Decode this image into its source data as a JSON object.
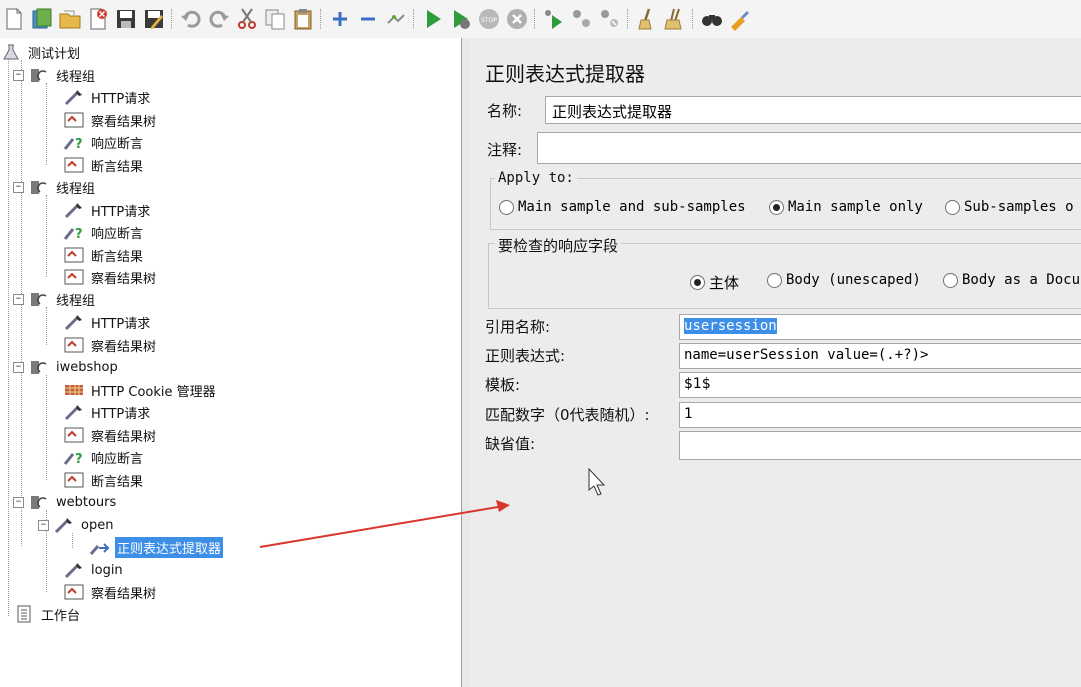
{
  "toolbar": {
    "icons": [
      "new-icon",
      "templates-icon",
      "open-icon",
      "close-icon",
      "save-icon",
      "save-as-icon",
      "undo-icon",
      "redo-icon",
      "cut-icon",
      "copy-icon",
      "paste-icon",
      "expand-icon",
      "collapse-icon",
      "toggle-icon",
      "start-icon",
      "start-no-pauses-icon",
      "stop-icon",
      "shutdown-icon",
      "remote-start-icon",
      "remote-stop-icon",
      "remote-shutdown-icon",
      "clear-icon",
      "clear-all-icon",
      "search-icon",
      "reset-search-icon"
    ]
  },
  "tree": {
    "test_plan": "测试计划",
    "groups": [
      {
        "label": "线程组",
        "children": [
          "HTTP请求",
          "察看结果树",
          "响应断言",
          "断言结果"
        ]
      },
      {
        "label": "线程组",
        "children": [
          "HTTP请求",
          "响应断言",
          "断言结果",
          "察看结果树"
        ]
      },
      {
        "label": "线程组",
        "children": [
          "HTTP请求",
          "察看结果树"
        ]
      },
      {
        "label": "iwebshop",
        "children": [
          "HTTP Cookie 管理器",
          "HTTP请求",
          "察看结果树",
          "响应断言",
          "断言结果"
        ]
      },
      {
        "label": "webtours",
        "open": "open",
        "extractor": "正则表达式提取器",
        "login": "login",
        "tree": "察看结果树"
      }
    ],
    "workbench": "工作台"
  },
  "panel": {
    "title": "正则表达式提取器",
    "name_label": "名称:",
    "name_value": "正则表达式提取器",
    "comment_label": "注释:",
    "comment_value": "",
    "apply_to": {
      "legend": "Apply to:",
      "options": [
        "Main sample and sub-samples",
        "Main sample only",
        "Sub-samples o"
      ],
      "selected": "Main sample only"
    },
    "response_field": {
      "legend": "要检查的响应字段",
      "options": [
        "主体",
        "Body (unescaped)",
        "Body as a Docu"
      ],
      "selected": "主体"
    },
    "ref_name_label": "引用名称:",
    "ref_name_value": "usersession",
    "regex_label": "正则表达式:",
    "regex_value": "name=userSession value=(.+?)>",
    "template_label": "模板:",
    "template_value": "$1$",
    "match_label": "匹配数字（0代表随机）:",
    "match_value": "1",
    "default_label": "缺省值:",
    "default_value": ""
  },
  "colors": {
    "selection": "#3d8ee6",
    "arrow": "#d9362b"
  }
}
